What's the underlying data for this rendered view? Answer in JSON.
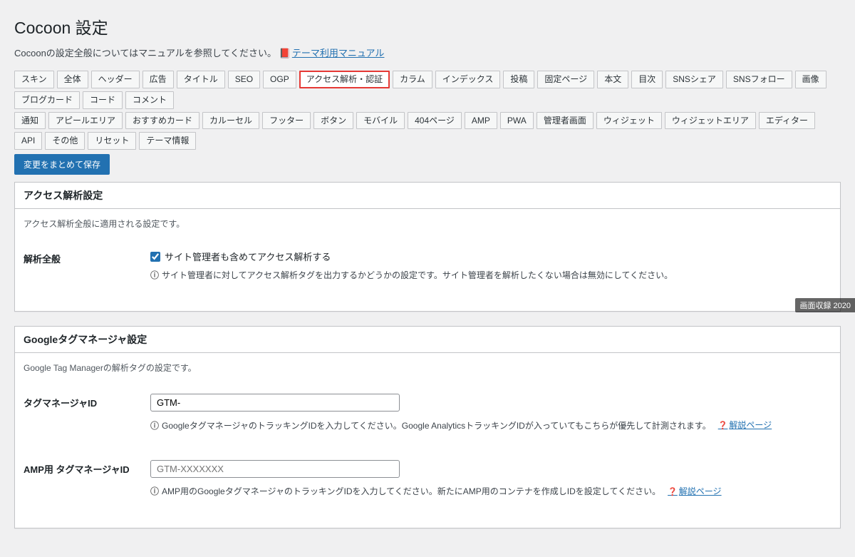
{
  "page": {
    "title": "Cocoon 設定",
    "description": "Cocoonの設定全般についてはマニュアルを参照してください。",
    "manual_link": "テーマ利用マニュアル"
  },
  "tabs_row1": [
    "スキン",
    "全体",
    "ヘッダー",
    "広告",
    "タイトル",
    "SEO",
    "OGP",
    "アクセス解析・認証",
    "カラム",
    "インデックス",
    "投稿",
    "固定ページ",
    "本文",
    "目次",
    "SNSシェア",
    "SNSフォロー",
    "画像",
    "ブログカード",
    "コード",
    "コメント"
  ],
  "tabs_row2": [
    "通知",
    "アピールエリア",
    "おすすめカード",
    "カルーセル",
    "フッター",
    "ボタン",
    "モバイル",
    "404ページ",
    "AMP",
    "PWA",
    "管理者画面",
    "ウィジェット",
    "ウィジェットエリア",
    "エディター",
    "API",
    "その他",
    "リセット",
    "テーマ情報"
  ],
  "active_tab": "アクセス解析・認証",
  "save_button": "変更をまとめて保存",
  "section1": {
    "title": "アクセス解析設定",
    "desc": "アクセス解析全般に適用される設定です。",
    "row1": {
      "label": "解析全般",
      "checkbox_label": "サイト管理者も含めてアクセス解析する",
      "help": "サイト管理者に対してアクセス解析タグを出力するかどうかの設定です。サイト管理者を解析したくない場合は無効にしてください。"
    }
  },
  "section2": {
    "title": "Googleタグマネージャ設定",
    "desc": "Google Tag Managerの解析タグの設定です。",
    "row1": {
      "label": "タグマネージャID",
      "value": "GTM-",
      "help": "GoogleタグマネージャのトラッキングIDを入力してください。Google AnalyticsトラッキングIDが入っていてもこちらが優先して計測されます。",
      "link": "解説ページ"
    },
    "row2": {
      "label": "AMP用 タグマネージャID",
      "placeholder": "GTM-XXXXXXX",
      "help": "AMP用のGoogleタグマネージャのトラッキングIDを入力してください。新たにAMP用のコンテナを作成しIDを設定してください。",
      "link": "解説ページ"
    }
  },
  "floating": "画面収録 2020"
}
